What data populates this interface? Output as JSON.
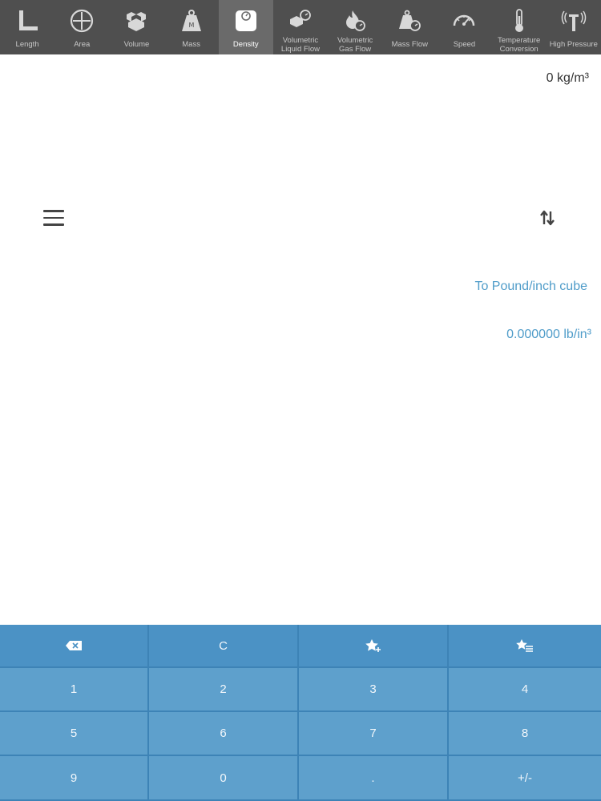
{
  "toolbar": {
    "items": [
      {
        "label": "Length",
        "icon": "ruler-square-icon",
        "active": false
      },
      {
        "label": "Area",
        "icon": "area-circle-icon",
        "active": false
      },
      {
        "label": "Volume",
        "icon": "boxes-icon",
        "active": false
      },
      {
        "label": "Mass",
        "icon": "weight-icon",
        "active": false
      },
      {
        "label": "Density",
        "icon": "scale-icon",
        "active": true
      },
      {
        "label": "Volumetric\nLiquid Flow",
        "icon": "liquid-flow-icon",
        "active": false
      },
      {
        "label": "Volumetric\nGas Flow",
        "icon": "gas-flow-icon",
        "active": false
      },
      {
        "label": "Mass Flow",
        "icon": "mass-flow-icon",
        "active": false
      },
      {
        "label": "Speed",
        "icon": "speedometer-icon",
        "active": false
      },
      {
        "label": "Temperature\nConversion",
        "icon": "thermometer-icon",
        "active": false
      },
      {
        "label": "High Pressure",
        "icon": "pressure-tower-icon",
        "active": false
      }
    ]
  },
  "display": {
    "input_value": "0 kg/m³",
    "target_unit": "To Pound/inch cube",
    "result_value": "0.000000 lb/in³"
  },
  "keypad": {
    "keys": [
      {
        "label": "",
        "name": "backspace-button",
        "icon": "backspace-icon",
        "fn": true
      },
      {
        "label": "C",
        "name": "clear-button",
        "icon": "",
        "fn": true
      },
      {
        "label": "",
        "name": "add-favorite-button",
        "icon": "star-plus-icon",
        "fn": true
      },
      {
        "label": "",
        "name": "favorites-list-button",
        "icon": "star-list-icon",
        "fn": true
      },
      {
        "label": "1",
        "name": "key-1",
        "icon": "",
        "fn": false
      },
      {
        "label": "2",
        "name": "key-2",
        "icon": "",
        "fn": false
      },
      {
        "label": "3",
        "name": "key-3",
        "icon": "",
        "fn": false
      },
      {
        "label": "4",
        "name": "key-4",
        "icon": "",
        "fn": false
      },
      {
        "label": "5",
        "name": "key-5",
        "icon": "",
        "fn": false
      },
      {
        "label": "6",
        "name": "key-6",
        "icon": "",
        "fn": false
      },
      {
        "label": "7",
        "name": "key-7",
        "icon": "",
        "fn": false
      },
      {
        "label": "8",
        "name": "key-8",
        "icon": "",
        "fn": false
      },
      {
        "label": "9",
        "name": "key-9",
        "icon": "",
        "fn": false
      },
      {
        "label": "0",
        "name": "key-0",
        "icon": "",
        "fn": false
      },
      {
        "label": ".",
        "name": "key-decimal",
        "icon": "",
        "fn": false
      },
      {
        "label": "+/-",
        "name": "key-sign",
        "icon": "",
        "fn": false
      }
    ]
  },
  "colors": {
    "toolbar_bg": "#4f4f4f",
    "toolbar_active": "#6a6a6a",
    "accent_text": "#4f9cc9",
    "keypad_key": "#5ea0cc",
    "keypad_fn": "#4b92c5"
  }
}
